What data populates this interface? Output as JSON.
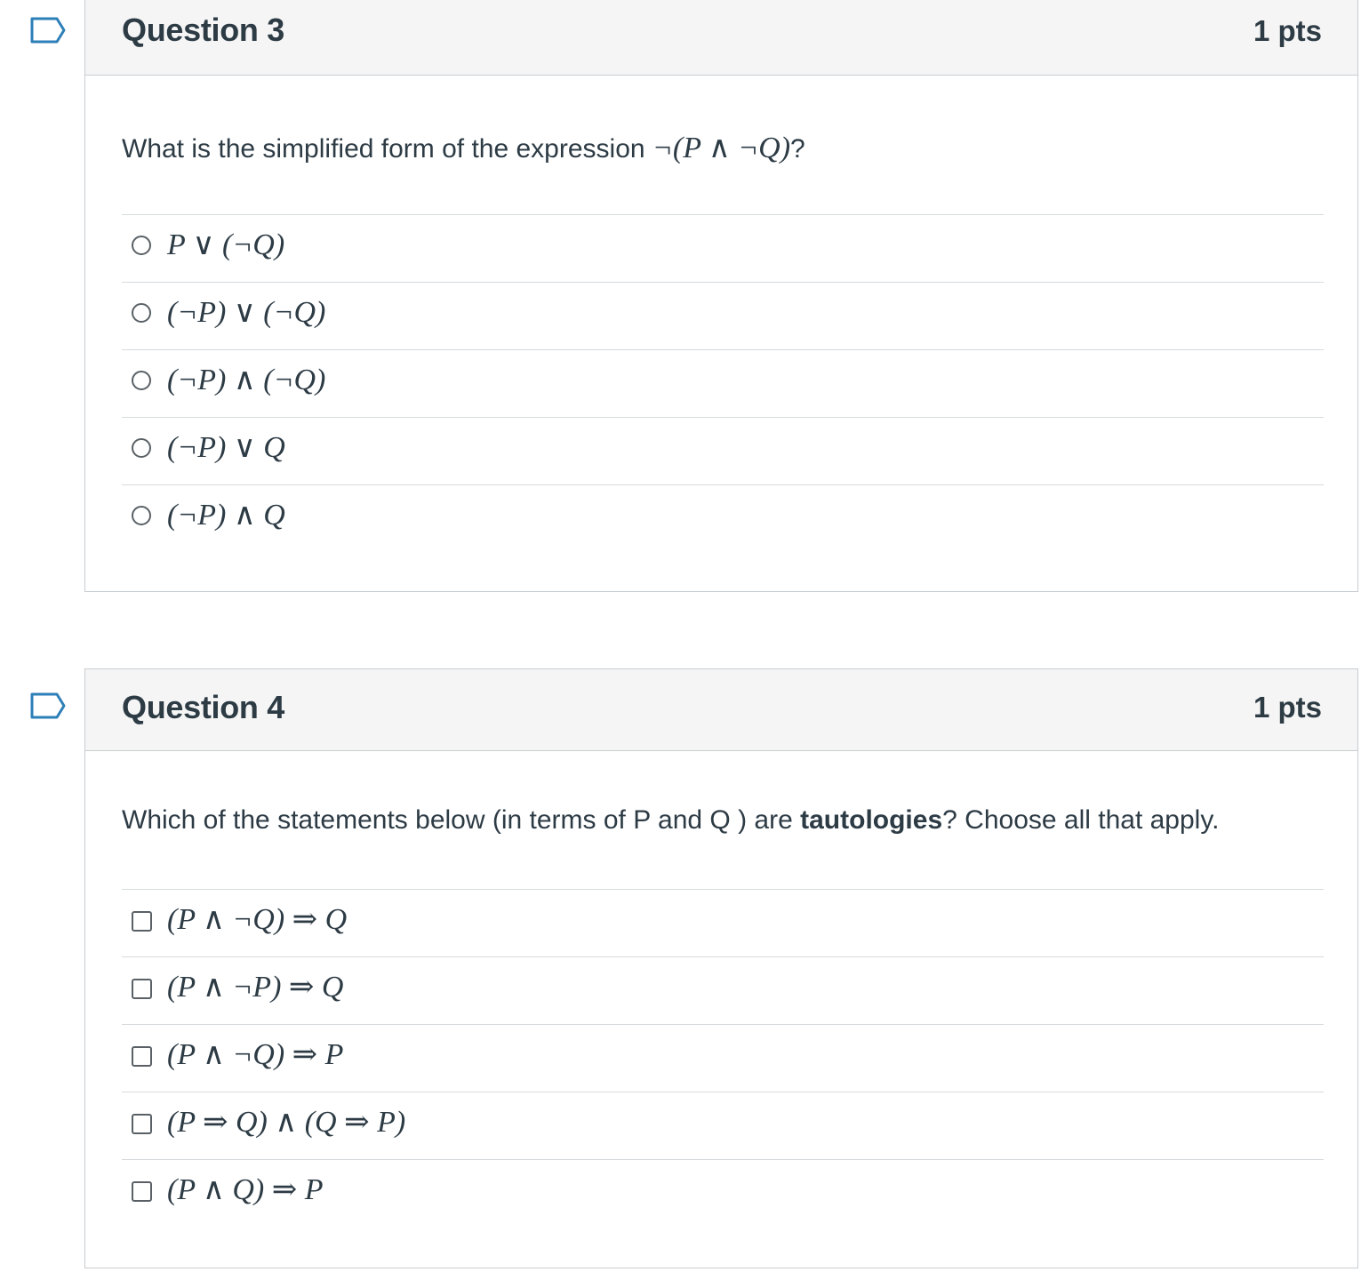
{
  "questions": [
    {
      "title": "Question 3",
      "points": "1 pts",
      "prompt_before": "What is the simplified form of the expression ",
      "prompt_math": "¬(P ∧ ¬Q)",
      "prompt_after": "?",
      "answer_type": "radio",
      "answers": [
        {
          "label": "P ∨ (¬Q)"
        },
        {
          "label": "(¬P) ∨ (¬Q)"
        },
        {
          "label": "(¬P) ∧ (¬Q)"
        },
        {
          "label": "(¬P) ∨ Q"
        },
        {
          "label": "(¬P) ∧ Q"
        }
      ]
    },
    {
      "title": "Question 4",
      "points": "1 pts",
      "prompt_before": "Which of the statements below (in terms of P and Q ) are  ",
      "prompt_bold": "tautologies",
      "prompt_after": "? Choose all that apply.",
      "answer_type": "checkbox",
      "answers": [
        {
          "label": "(P ∧ ¬Q) ⇒ Q"
        },
        {
          "label": "(P ∧ ¬P) ⇒ Q"
        },
        {
          "label": "(P ∧ ¬Q) ⇒ P"
        },
        {
          "label": "(P ⇒ Q) ∧ (Q ⇒ P)"
        },
        {
          "label": "(P ∧ Q) ⇒ P"
        }
      ]
    }
  ],
  "colors": {
    "header_bg": "#f5f5f5",
    "border": "#c7cdd1",
    "flag": "#2d7fb8",
    "text": "#2d3b45"
  },
  "icons": {
    "flag": "bookmark-flag-icon",
    "radio": "radio-button",
    "checkbox": "checkbox"
  }
}
